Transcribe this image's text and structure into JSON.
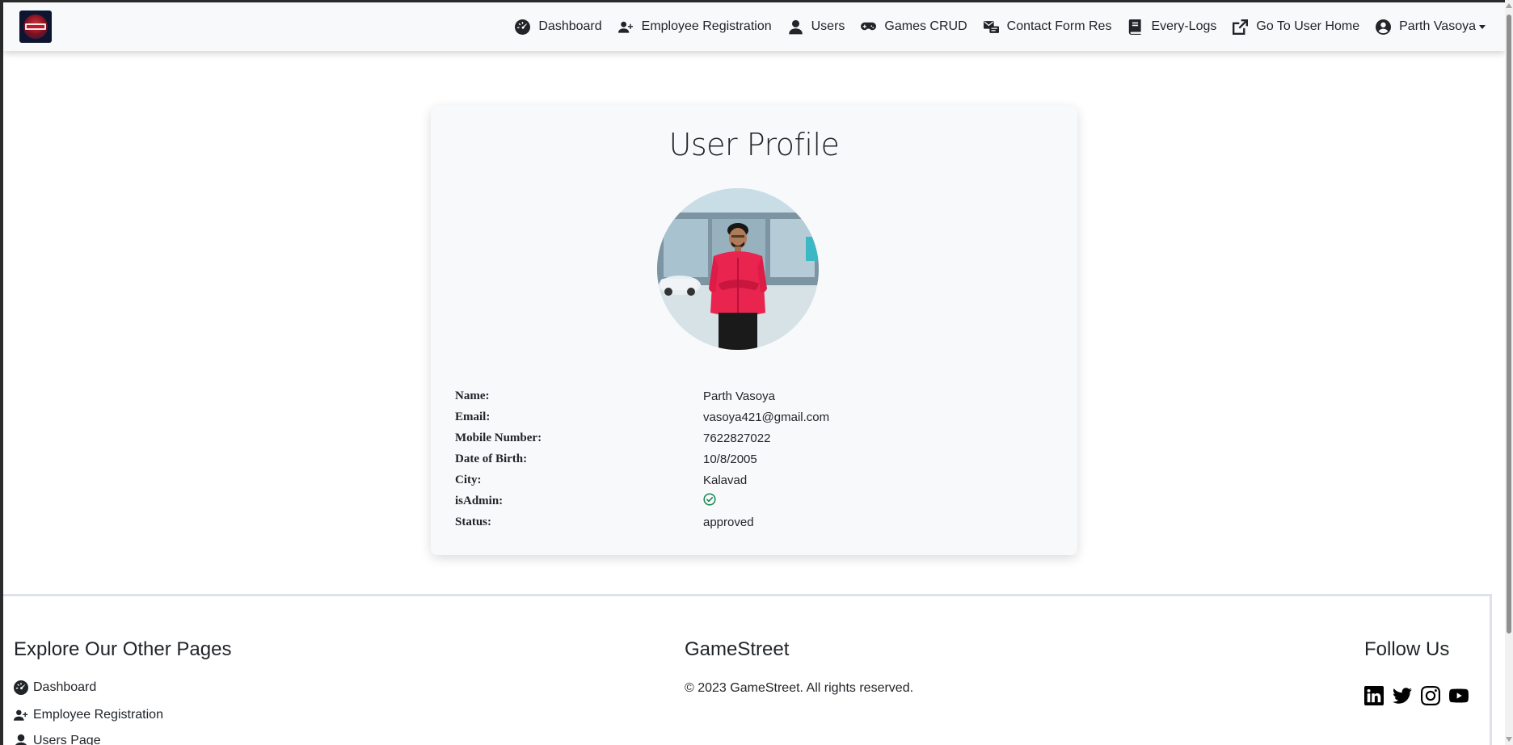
{
  "navbar": {
    "logo_alt": "ACTION",
    "items": [
      {
        "label": "Dashboard",
        "icon": "dashboard-gauge-icon"
      },
      {
        "label": "Employee Registration",
        "icon": "user-plus-icon"
      },
      {
        "label": "Users",
        "icon": "user-icon"
      },
      {
        "label": "Games CRUD",
        "icon": "gamepad-icon"
      },
      {
        "label": "Contact Form Res",
        "icon": "contact-form-icon"
      },
      {
        "label": "Every-Logs",
        "icon": "book-icon"
      },
      {
        "label": "Go To User Home",
        "icon": "external-link-icon"
      },
      {
        "label": "Parth Vasoya",
        "icon": "user-circle-icon"
      }
    ]
  },
  "profile": {
    "title": "User Profile",
    "fields": [
      {
        "label": "Name:",
        "value": "Parth Vasoya"
      },
      {
        "label": "Email:",
        "value": "vasoya421@gmail.com"
      },
      {
        "label": "Mobile Number:",
        "value": "7622827022"
      },
      {
        "label": "Date of Birth:",
        "value": "10/8/2005"
      },
      {
        "label": "City:",
        "value": "Kalavad"
      },
      {
        "label": "isAdmin:",
        "value": "",
        "icon": "check-circle-icon"
      },
      {
        "label": "Status:",
        "value": "approved"
      }
    ]
  },
  "footer": {
    "explore_heading": "Explore Our Other Pages",
    "links": [
      {
        "label": "Dashboard",
        "icon": "dashboard-gauge-icon"
      },
      {
        "label": "Employee Registration",
        "icon": "user-plus-icon"
      },
      {
        "label": "Users Page",
        "icon": "user-icon"
      }
    ],
    "brand_heading": "GameStreet",
    "copyright": "© 2023 GameStreet. All rights reserved.",
    "follow_heading": "Follow Us",
    "social": [
      "linkedin-icon",
      "twitter-icon",
      "instagram-icon",
      "youtube-icon"
    ]
  },
  "colors": {
    "navbar_bg": "#f8f9fa",
    "card_bg": "#f8f9fa",
    "admin_check": "#198754"
  }
}
